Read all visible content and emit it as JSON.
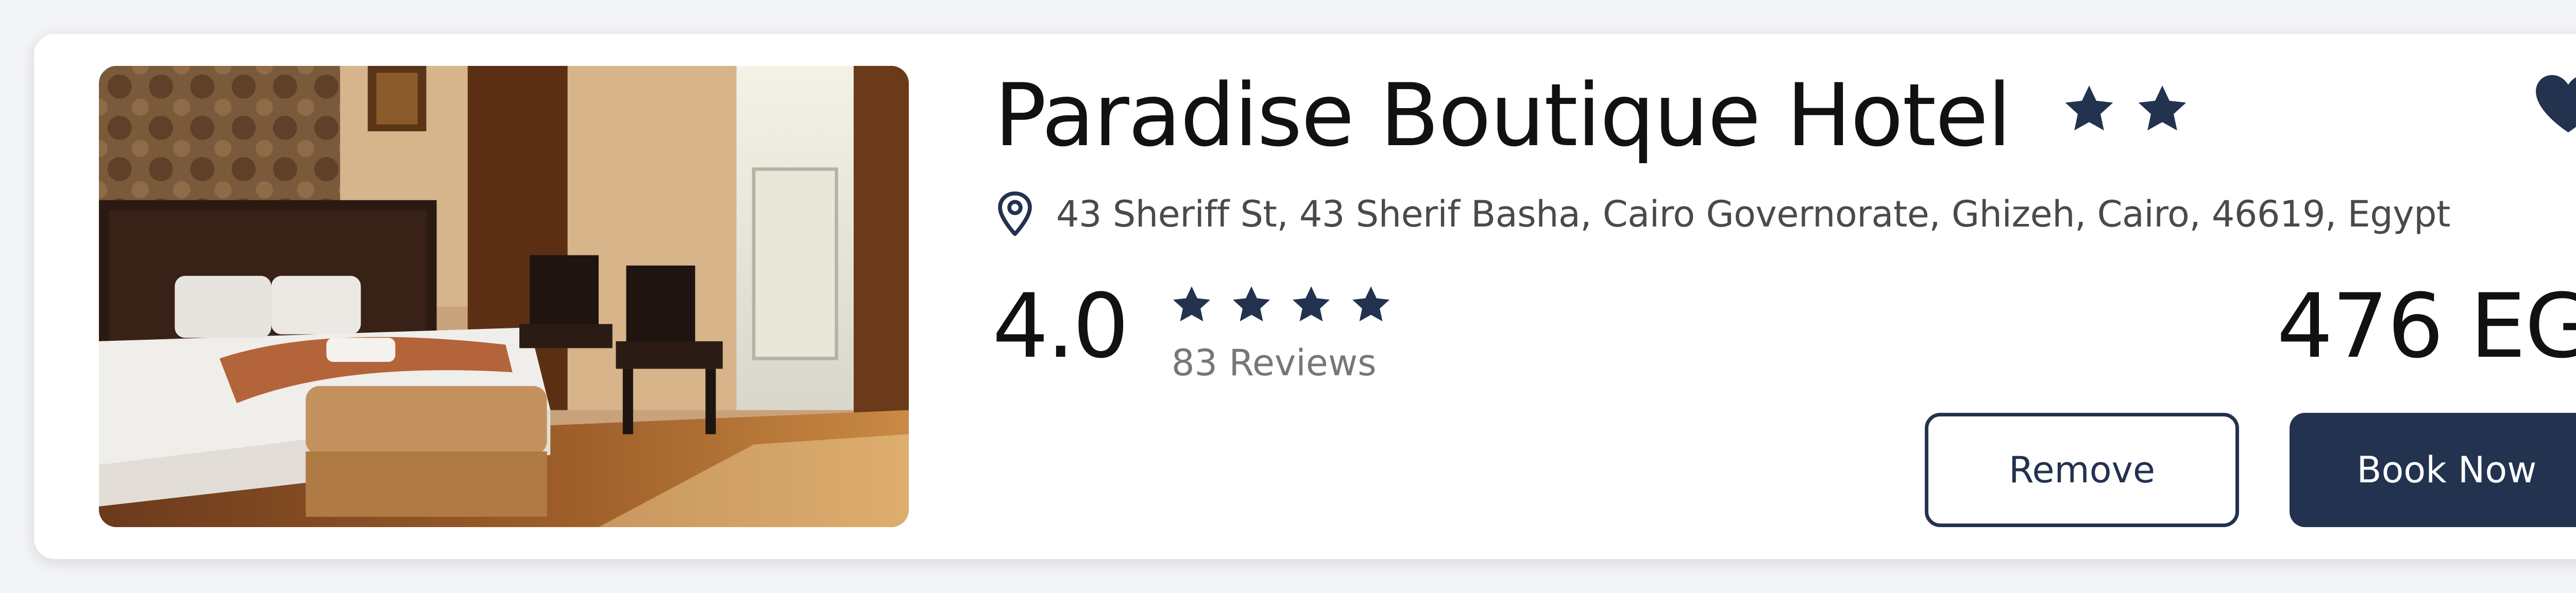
{
  "hotel": {
    "name": "Paradise Boutique Hotel",
    "hotel_class_stars": 2,
    "address": "43 Sheriff St, 43 Sherif Basha, Cairo Governorate, Ghizeh, Cairo, 46619, Egypt",
    "rating": "4.0",
    "rating_stars": 4,
    "reviews": "83 Reviews",
    "price": "476 EG",
    "favorited": true
  },
  "actions": {
    "remove_label": "Remove",
    "book_label": "Book Now"
  },
  "colors": {
    "accent": "#22324f",
    "card": "#ffffff",
    "background": "#f3f4f6"
  },
  "icons": {
    "favorite": "heart-icon",
    "location": "map-pin-icon",
    "rating": "star-icon"
  }
}
